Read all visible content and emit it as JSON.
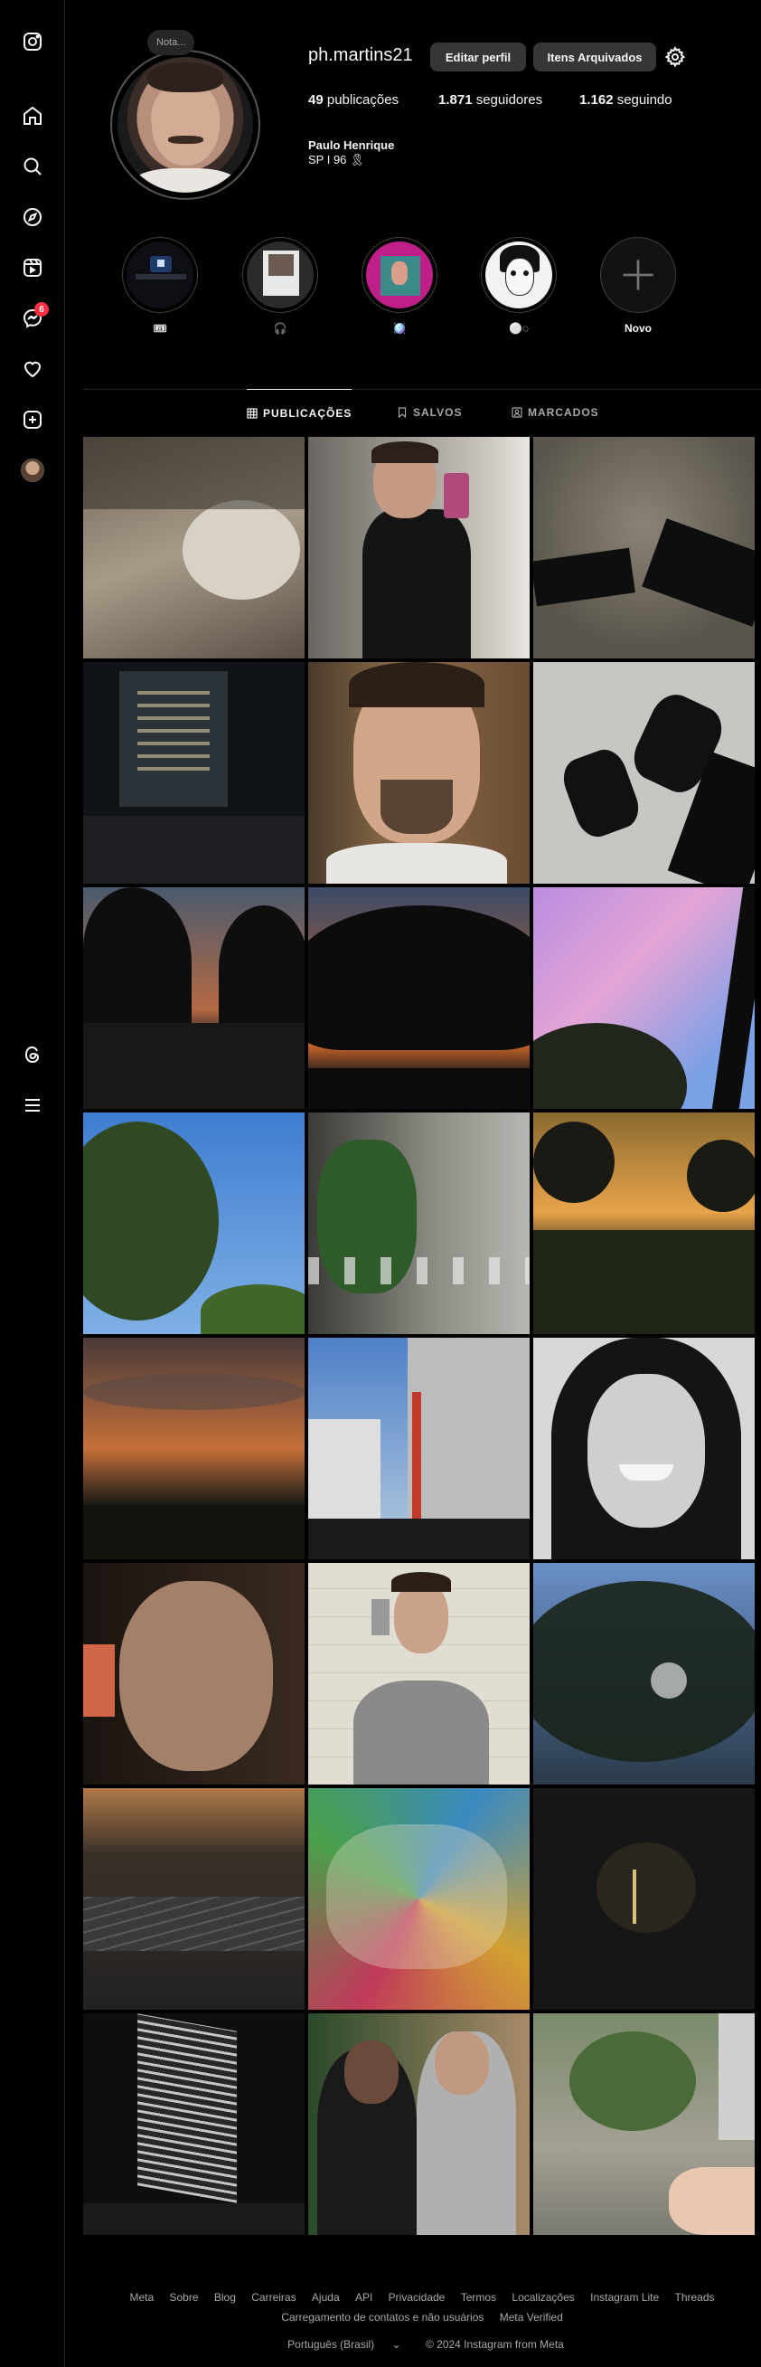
{
  "nav": {
    "badge_count": "6"
  },
  "profile": {
    "note_placeholder": "Nota...",
    "username": "ph.martins21",
    "edit_profile_label": "Editar perfil",
    "archived_label": "Itens Arquivados",
    "posts_count": "49",
    "posts_label": "publicações",
    "followers_count": "1.871",
    "followers_label": "seguidores",
    "following_count": "1.162",
    "following_label": "seguindo",
    "full_name": "Paulo Henrique",
    "bio": "SP I 96 🎗"
  },
  "highlights": [
    {
      "label": "🎟"
    },
    {
      "label": "🎧"
    },
    {
      "label": "🪩"
    },
    {
      "label": "⚪◌"
    },
    {
      "label": "Novo"
    }
  ],
  "tabs": [
    {
      "label": "PUBLICAÇÕES",
      "active": true
    },
    {
      "label": "SALVOS",
      "active": false
    },
    {
      "label": "MARCADOS",
      "active": false
    }
  ],
  "footer": {
    "links": [
      "Meta",
      "Sobre",
      "Blog",
      "Carreiras",
      "Ajuda",
      "API",
      "Privacidade",
      "Termos",
      "Localizações",
      "Instagram Lite",
      "Threads",
      "Carregamento de contatos e não usuários",
      "Meta Verified"
    ],
    "language": "Português (Brasil)",
    "copyright": "© 2024 Instagram from Meta"
  },
  "colors": {
    "background": "#000000",
    "button": "#363636",
    "badge": "#ff3040",
    "muted_text": "#a8a8a8"
  }
}
